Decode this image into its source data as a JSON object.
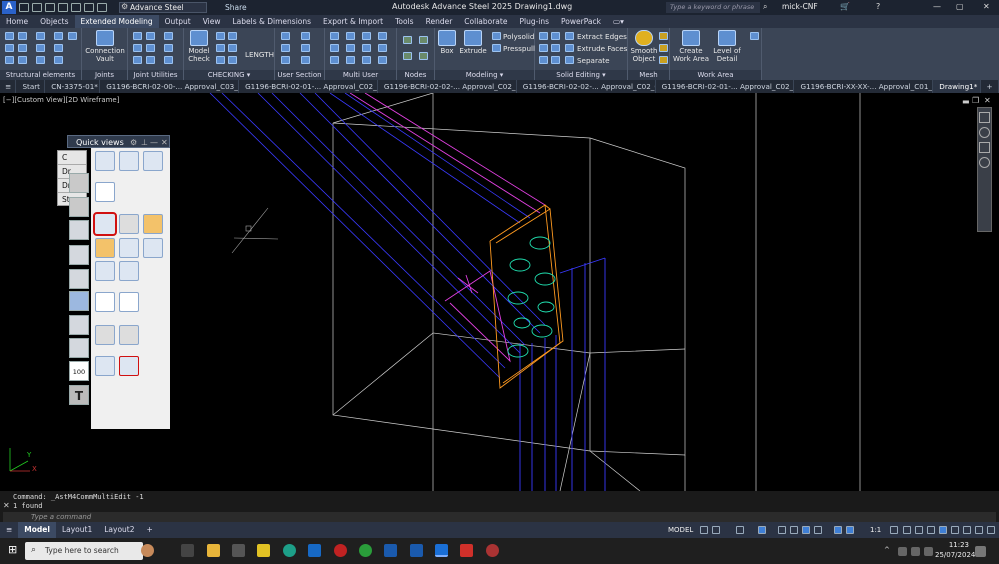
{
  "titlebar": {
    "app_letter": "A",
    "workspace": "Advance Steel",
    "share": "Share",
    "title": "Autodesk Advance Steel 2025    Drawing1.dwg",
    "search_placeholder": "Type a keyword or phrase",
    "user": "mick-CNF"
  },
  "menu_tabs": [
    "Home",
    "Objects",
    "Extended Modeling",
    "Output",
    "View",
    "Labels & Dimensions",
    "Export & Import",
    "Tools",
    "Render",
    "Collaborate",
    "Plug-ins",
    "PowerPack"
  ],
  "ribbon": {
    "groups": [
      "Structural elements",
      "Joints",
      "Joint Utilities",
      "CHECKING ▾",
      "User Section",
      "Multi User",
      "Nodes",
      "Modeling ▾",
      "Solid Editing ▾",
      "Mesh",
      "Work Area"
    ],
    "connection_vault": "Connection Vault",
    "model_check": "Model Check",
    "length": "LENGTH",
    "box": "Box",
    "extrude": "Extrude",
    "polysolid": "Polysolid",
    "presspull": "Presspull",
    "extract_edges": "Extract Edges",
    "extrude_faces": "Extrude Faces",
    "separate": "Separate",
    "smooth_object": "Smooth Object",
    "create_work_area": "Create Work Area",
    "level_of_detail": "Level of Detail"
  },
  "doc_tabs": [
    "Start",
    "CN-3375-01*",
    "G1196-BCRI-02-00-... Approval_C03_1*",
    "G1196-BCRI-02-01-... Approval_C02_1*",
    "G1196-BCRI-02-02-... Approval_C02_1*",
    "G1196-BCRI-02-02-... Approval_C02_0*",
    "G1196-BCRI-02-01-... Approval_C02_0*",
    "G1196-BCRI-XX-XX-... Approval_C01_1*",
    "Drawing1*"
  ],
  "active_doc_tab": "Drawing1*",
  "viewport": {
    "label": "[−][Custom View][2D Wireframe]",
    "behind_labels": [
      "C",
      "Dr",
      "Dr",
      "Sta"
    ]
  },
  "quick_views": {
    "title": "Quick views",
    "icon_label_100": "100",
    "icon_label_t": "T"
  },
  "command": {
    "line1": "Command: _AstM4CommMultiEdit -1",
    "line2": "1 found",
    "placeholder": "Type a command"
  },
  "status": {
    "layouts": [
      "Model",
      "Layout1",
      "Layout2"
    ],
    "model_label": "MODEL",
    "scale": "1:1"
  },
  "taskbar": {
    "search_placeholder": "Type here to search",
    "time": "11:23",
    "date": "25/07/2024"
  },
  "colors": {
    "wire_blue": "#3a3aff",
    "wire_magenta": "#e040e0",
    "plate_orange": "#ff9a20",
    "bolt_green": "#20e0b0",
    "highlight_red": "#d01010"
  }
}
